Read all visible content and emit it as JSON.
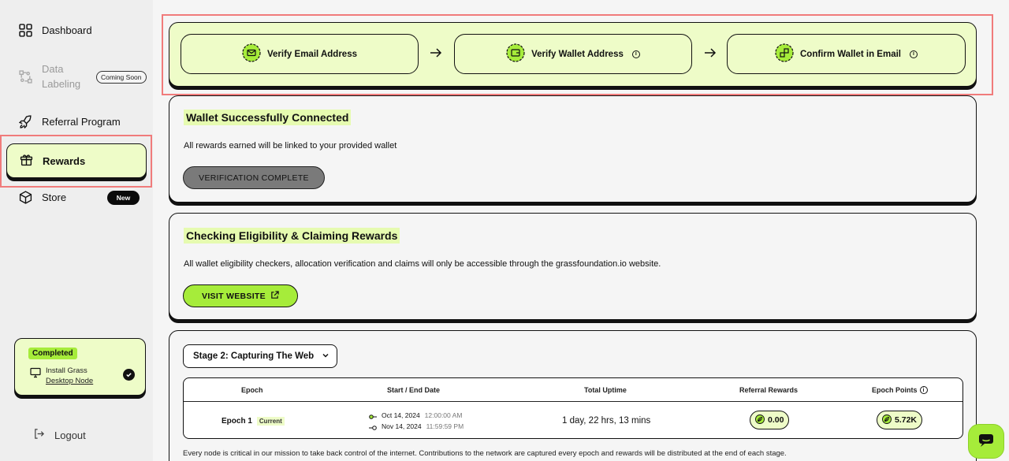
{
  "sidebar": {
    "items": [
      {
        "label": "Dashboard",
        "icon": "grid-icon"
      },
      {
        "label": "Data Labeling",
        "icon": "data-labeling-icon",
        "badge": "Coming Soon"
      },
      {
        "label": "Referral Program",
        "icon": "rocket-icon"
      },
      {
        "label": "Rewards",
        "icon": "gift-icon",
        "active": true
      },
      {
        "label": "Store",
        "icon": "cube-icon",
        "badge": "New"
      }
    ],
    "completed_card": {
      "badge": "Completed",
      "line1": "Install Grass",
      "line2": "Desktop Node"
    },
    "logout": "Logout"
  },
  "steps": [
    {
      "label": "Verify Email Address",
      "icon": "envelope-icon"
    },
    {
      "label": "Verify Wallet Address",
      "icon": "wallet-icon",
      "info": true
    },
    {
      "label": "Confirm Wallet in Email",
      "icon": "link-icon",
      "info": true
    }
  ],
  "wallet_card": {
    "title": "Wallet Successfully Connected",
    "description": "All rewards earned will be linked to your provided wallet",
    "button": "VERIFICATION COMPLETE"
  },
  "eligibility_card": {
    "title": "Checking Eligibility & Claiming Rewards",
    "description": "All wallet eligibility checkers, allocation verification and claims will only be accessible through the grassfoundation.io website.",
    "button": "VISIT WEBSITE"
  },
  "stage_card": {
    "selected_stage": "Stage 2: Capturing The Web",
    "table": {
      "headers": [
        "Epoch",
        "Start / End Date",
        "Total Uptime",
        "Referral Rewards",
        "Epoch Points"
      ],
      "row": {
        "epoch": "Epoch 1",
        "badge": "Current",
        "start_date": "Oct 14, 2024",
        "start_time": "12:00:00 AM",
        "end_date": "Nov 14, 2024",
        "end_time": "11:59:59 PM",
        "uptime": "1 day, 22 hrs, 13 mins",
        "referral_rewards": "0.00",
        "epoch_points": "5.72K"
      }
    },
    "footnote": "Every node is critical in our mission to take back control of the internet. Contributions to the network are captured every epoch and rewards will be distributed at the end of each stage."
  },
  "colors": {
    "accent_green": "#a6ec3a",
    "pale_green": "#eefcc8",
    "highlight_red": "#f07b7b"
  }
}
